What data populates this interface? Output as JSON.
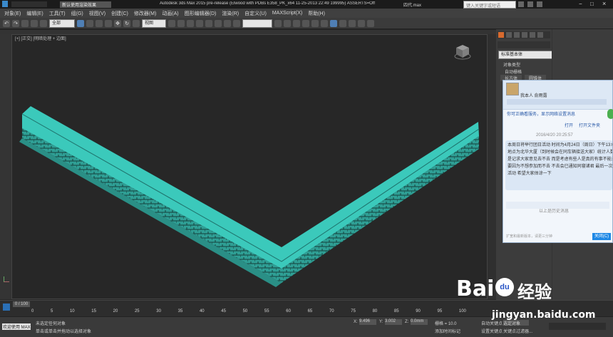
{
  "window": {
    "app_title": "Autodesk 3ds Max  2015 pre-release (Elwood with PDBs E358_PK_x64 11-25-2013 22:49 199995) ASSERTS=Off",
    "file_name": "四代.max",
    "tab_label": "新认使用渲染效果",
    "search_placeholder": "键入关键字或短语"
  },
  "menu": {
    "items": [
      "对象(E)",
      "编辑(E)",
      "工具(T)",
      "组(G)",
      "视图(V)",
      "创建(C)",
      "修改器(M)",
      "动画(A)",
      "图形编辑器(D)",
      "渲染(R)",
      "自定义(U)",
      "MAXScript(X)",
      "帮助(H)"
    ]
  },
  "toolbar": {
    "select_filter": "全部",
    "ref_coord": "视图"
  },
  "viewport": {
    "label": "[+] [正交] [明暗处理 + 边面]"
  },
  "command_panel": {
    "dropdown": "标准基本体",
    "rollout_object_type": "对象类型",
    "auto_grid": "自动栅格",
    "btn_box": "长方体",
    "btn_cone": "圆锥体"
  },
  "qq_chat": {
    "name": "我本人 俞雨露",
    "tip": "你可正确看服务，显示网络设置消息",
    "links": [
      "打开",
      "打开文件夹"
    ],
    "timestamp": "2016/4/20 20:25:57",
    "message_lines": [
      "本周日将举行团日活动 时间为4月24日（周日）下午13:00",
      "地点为北华大厦（到时候会在同车辆接送大家）统计人数",
      "是记求大家意见去不去 而是考虑有些人是真的有事不能去",
      "要因为不想参加而不去 不去会已通知同寝诸君 最后一次",
      "活动 希望大家体谅一下"
    ],
    "history_link": "以上是历史消息",
    "input_placeholder": "扩宽和最新版本，请更三分钟",
    "close_button": "关闭(C)"
  },
  "timeline": {
    "frame_readout": "0 / 100",
    "ticks": [
      "0",
      "5",
      "10",
      "15",
      "20",
      "25",
      "30",
      "35",
      "40",
      "45",
      "50",
      "55",
      "60",
      "65",
      "70",
      "75",
      "80",
      "85",
      "90",
      "95",
      "100"
    ]
  },
  "status": {
    "welcome": "欢迎使用 MAXSc",
    "line1": "未选定任何对象",
    "line2": "单击或单击并拖动以选择对象",
    "x_label": "X:",
    "y_label": "Y:",
    "z_label": "Z:",
    "x_value": "9.496",
    "y_value": "3.002",
    "z_value": "0.0mm",
    "grid_label": "栅格 = 10.0",
    "add_time_tag": "添加时间标记",
    "auto_key": "自动关键点",
    "set_key": "设置关键点",
    "selected": "选定对象",
    "key_filters": "关键点过滤器..."
  },
  "watermark": {
    "brand": "Bai",
    "paw": "du",
    "suffix": "经验",
    "url": "jingyan.baidu.com"
  }
}
